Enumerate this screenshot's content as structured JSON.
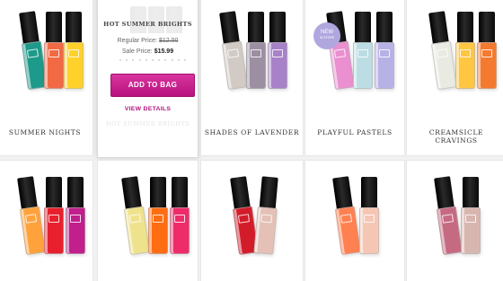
{
  "products": [
    {
      "name": "SUMMER NIGHTS",
      "colors": [
        "#1d9a8a",
        "#f26a44",
        "#ffd12a"
      ]
    },
    {
      "name": "HOT SUMMER BRIGHTS",
      "colors": [
        "#e8e8e8",
        "#e8e8e8",
        "#e8e8e8"
      ]
    },
    {
      "name": "SHADES OF LAVENDER",
      "colors": [
        "#d2cac4",
        "#9c8fa2",
        "#a782c9"
      ]
    },
    {
      "name": "PLAYFUL PASTELS",
      "colors": [
        "#ea8fcf",
        "#bcdde3",
        "#b7b2e6"
      ]
    },
    {
      "name": "CREAMSICLE CRAVINGS",
      "colors": [
        "#e9eae1",
        "#ffc642",
        "#f47a2f"
      ]
    },
    {
      "name": "",
      "colors": [
        "#ffa23c",
        "#e8202d",
        "#c01f8c"
      ]
    },
    {
      "name": "",
      "colors": [
        "#efe28c",
        "#ff6d12",
        "#ee2c6a"
      ]
    },
    {
      "name": "",
      "colors": [
        "#d31c2a",
        "#e4c0b6"
      ]
    },
    {
      "name": "",
      "colors": [
        "#ff8050",
        "#f6c6b5"
      ]
    },
    {
      "name": "",
      "colors": [
        "#c66a82",
        "#d8b6b0"
      ]
    }
  ],
  "hover": {
    "title": "HOT SUMMER BRIGHTS",
    "regular_label": "Regular Price:",
    "regular_price": "$12.00",
    "sale_label": "Sale Price:",
    "sale_price": "$15.99",
    "add_button": "ADD TO BAG",
    "details_link": "VIEW DETAILS",
    "ghost_title": "HOT SUMMER BRIGHTS"
  },
  "badge": {
    "line1": "NEW",
    "line2": "IN STORE"
  },
  "colors": {
    "accent": "#c4228c",
    "badge": "#b0a7df"
  }
}
